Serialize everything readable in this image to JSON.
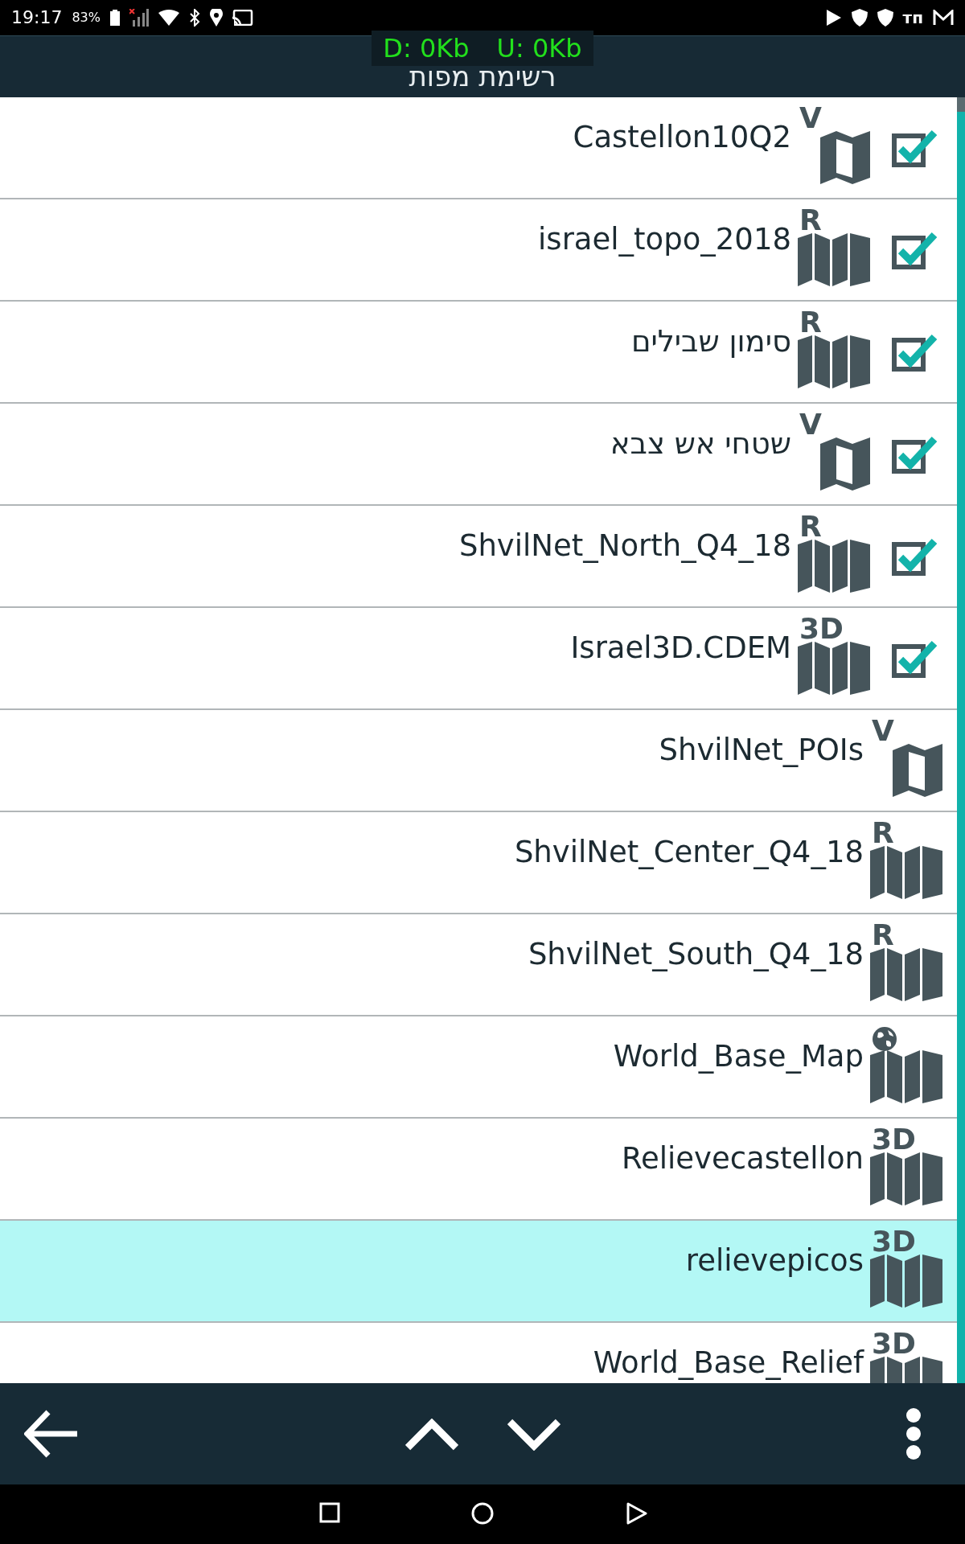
{
  "status_bar": {
    "time": "19:17",
    "battery": "83%",
    "notification_text": "тп"
  },
  "header": {
    "title": "רשימת מפות",
    "download": "D: 0Kb",
    "upload": "U: 0Kb"
  },
  "maps": [
    {
      "name": "Castellon10Q2",
      "kind": "vector",
      "badge": "V",
      "checked": true,
      "selected": false
    },
    {
      "name": "israel_topo_2018",
      "kind": "raster",
      "badge": "R",
      "checked": true,
      "selected": false
    },
    {
      "name": "סימון שבילים",
      "kind": "raster",
      "badge": "R",
      "checked": true,
      "selected": false
    },
    {
      "name": "שטחי אש צבא",
      "kind": "vector",
      "badge": "V",
      "checked": true,
      "selected": false
    },
    {
      "name": "ShvilNet_North_Q4_18",
      "kind": "raster",
      "badge": "R",
      "checked": true,
      "selected": false
    },
    {
      "name": "Israel3D.CDEM",
      "kind": "relief",
      "badge": "3D",
      "checked": true,
      "selected": false
    },
    {
      "name": "ShvilNet_POIs",
      "kind": "vector",
      "badge": "V",
      "selected": false
    },
    {
      "name": "ShvilNet_Center_Q4_18",
      "kind": "raster",
      "badge": "R",
      "selected": false
    },
    {
      "name": "ShvilNet_South_Q4_18",
      "kind": "raster",
      "badge": "R",
      "selected": false
    },
    {
      "name": "World_Base_Map",
      "kind": "world",
      "selected": false
    },
    {
      "name": "Relievecastellon",
      "kind": "relief",
      "badge": "3D",
      "selected": false
    },
    {
      "name": "relievepicos",
      "kind": "relief",
      "badge": "3D",
      "selected": true
    },
    {
      "name": "World_Base_Relief",
      "kind": "relief",
      "badge": "3D",
      "selected": false
    }
  ]
}
